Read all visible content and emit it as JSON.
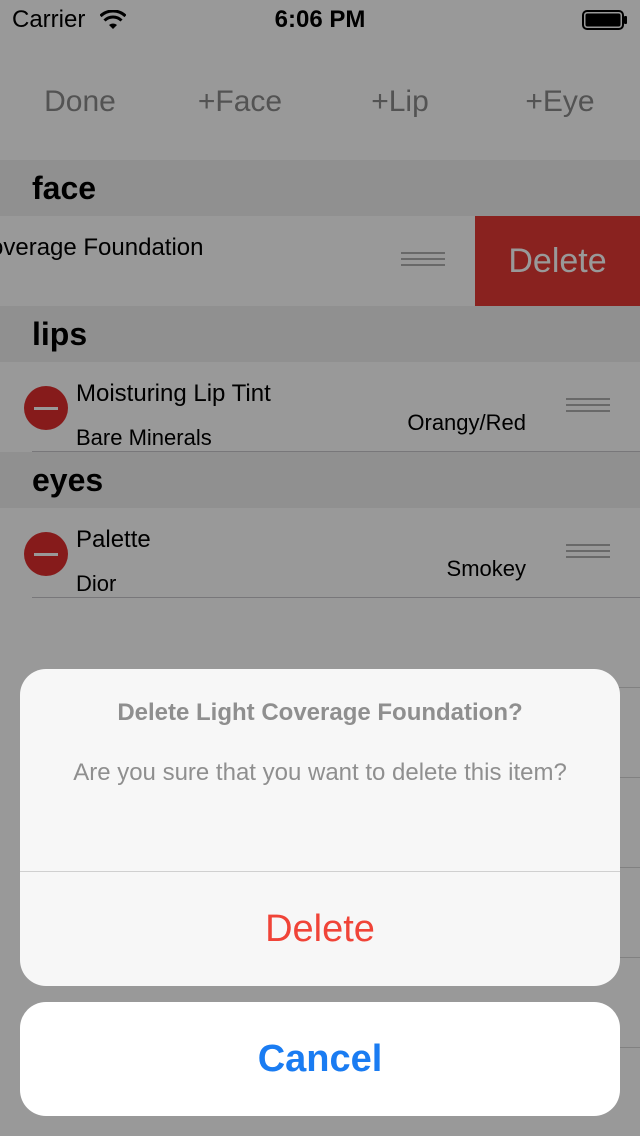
{
  "status_bar": {
    "carrier": "Carrier",
    "time": "6:06 PM"
  },
  "toolbar": {
    "done": "Done",
    "add_face": "+Face",
    "add_lip": "+Lip",
    "add_eye": "+Eye"
  },
  "sections": {
    "face": {
      "header": "face",
      "row": {
        "name": "overage Foundation",
        "delete_action": "Delete"
      }
    },
    "lips": {
      "header": "lips",
      "row": {
        "name": "Moisturing Lip Tint",
        "brand": "Bare Minerals",
        "shade": "Orangy/Red"
      }
    },
    "eyes": {
      "header": "eyes",
      "row": {
        "name": "Palette",
        "brand": "Dior",
        "shade": "Smokey"
      }
    }
  },
  "action_sheet": {
    "title": "Delete Light Coverage Foundation?",
    "message": "Are you sure that you want to delete this item?",
    "delete": "Delete",
    "cancel": "Cancel"
  },
  "colors": {
    "delete_red": "#e53935",
    "destructive_text": "#f04438",
    "cancel_blue": "#1a7cf2",
    "minus_red": "#e02d2d"
  }
}
